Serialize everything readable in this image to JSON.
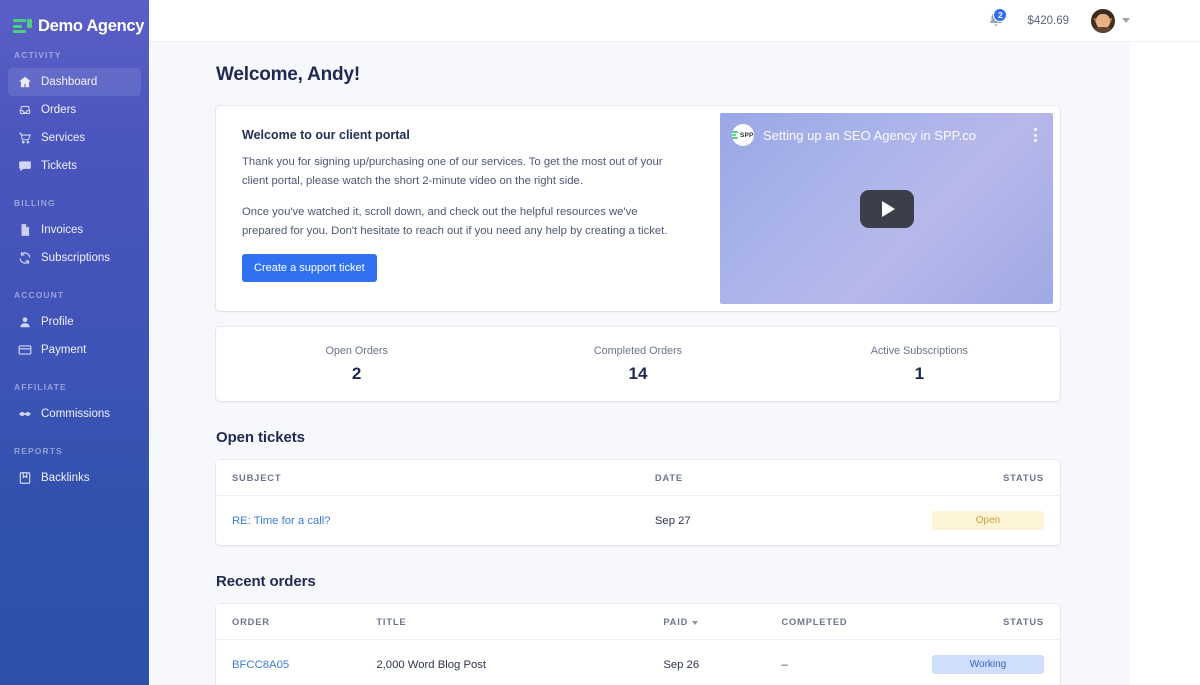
{
  "brand": {
    "name": "Demo Agency",
    "logo_icon": "spp-bars-logo"
  },
  "sidebar": {
    "groups": [
      {
        "label": "ACTIVITY",
        "items": [
          {
            "label": "Dashboard",
            "icon": "home-icon",
            "active": true
          },
          {
            "label": "Orders",
            "icon": "inbox-icon",
            "active": false
          },
          {
            "label": "Services",
            "icon": "cart-icon",
            "active": false
          },
          {
            "label": "Tickets",
            "icon": "chat-bubble-icon",
            "active": false
          }
        ]
      },
      {
        "label": "BILLING",
        "items": [
          {
            "label": "Invoices",
            "icon": "document-icon",
            "active": false
          },
          {
            "label": "Subscriptions",
            "icon": "refresh-cycle-icon",
            "active": false
          }
        ]
      },
      {
        "label": "ACCOUNT",
        "items": [
          {
            "label": "Profile",
            "icon": "user-icon",
            "active": false
          },
          {
            "label": "Payment",
            "icon": "credit-card-icon",
            "active": false
          }
        ]
      },
      {
        "label": "AFFILIATE",
        "items": [
          {
            "label": "Commissions",
            "icon": "handshake-icon",
            "active": false
          }
        ]
      },
      {
        "label": "REPORTS",
        "items": [
          {
            "label": "Backlinks",
            "icon": "book-icon",
            "active": false
          }
        ]
      }
    ]
  },
  "topbar": {
    "notifications_icon": "bell-icon",
    "notifications_count": "2",
    "balance": "$420.69",
    "avatar_icon": "user-avatar",
    "caret_icon": "chevron-down-icon"
  },
  "page": {
    "title": "Welcome, Andy!"
  },
  "welcome": {
    "heading": "Welcome to our client portal",
    "paragraph1": "Thank you for signing up/purchasing one of our services. To get the most out of your client portal, please watch the short 2-minute video on the right side.",
    "paragraph2": "Once you've watched it, scroll down, and check out the helpful resources we've prepared for you. Don't hesitate to reach out if you need any help by creating a ticket.",
    "cta_label": "Create a support ticket",
    "video": {
      "channel_badge": "SPP",
      "title": "Setting up an SEO Agency in SPP.co",
      "play_icon": "play-icon",
      "menu_icon": "kebab-menu-icon"
    }
  },
  "stats": [
    {
      "label": "Open Orders",
      "value": "2"
    },
    {
      "label": "Completed Orders",
      "value": "14"
    },
    {
      "label": "Active Subscriptions",
      "value": "1"
    }
  ],
  "tickets": {
    "title": "Open tickets",
    "columns": [
      "SUBJECT",
      "DATE",
      "STATUS"
    ],
    "rows": [
      {
        "subject": "RE: Time for a call?",
        "date": "Sep 27",
        "status": "Open"
      }
    ]
  },
  "orders": {
    "title": "Recent orders",
    "columns": [
      "ORDER",
      "TITLE",
      "PAID",
      "COMPLETED",
      "STATUS"
    ],
    "sorted_column": "PAID",
    "rows": [
      {
        "order": "BFCC8A05",
        "title": "2,000 Word Blog Post",
        "paid": "Sep 26",
        "completed": "–",
        "status": "Working"
      }
    ]
  },
  "colors": {
    "sidebar_top": "#5a5fc7",
    "sidebar_bottom": "#2c51ac",
    "accent_blue": "#3071f2",
    "logo_green": "#4ad07f",
    "status_open_bg": "#fdf3d6",
    "status_open_text": "#caa23c",
    "status_working_bg": "#cfdefc",
    "status_working_text": "#3565c4",
    "page_bg": "#f7f8fb"
  }
}
